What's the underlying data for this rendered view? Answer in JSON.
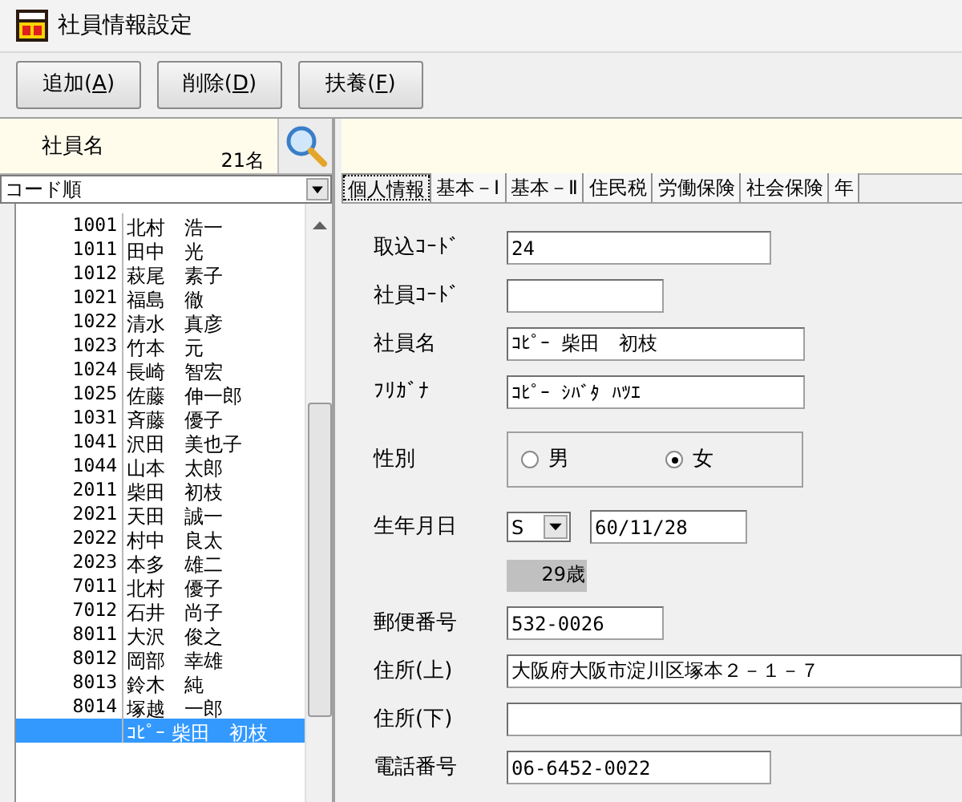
{
  "window": {
    "title": "社員情報設定"
  },
  "toolbar": [
    {
      "label": "追加(",
      "key": "A",
      "tail": ")"
    },
    {
      "label": "削除(",
      "key": "D",
      "tail": ")"
    },
    {
      "label": "扶養(",
      "key": "F",
      "tail": ")"
    }
  ],
  "employee_panel": {
    "label": "社員名",
    "count": "21名",
    "sort": "コード順",
    "rows": [
      {
        "code": "1001",
        "name": "北村　浩一",
        "selected": false
      },
      {
        "code": "1011",
        "name": "田中　光",
        "selected": false
      },
      {
        "code": "1012",
        "name": "萩尾　素子",
        "selected": false
      },
      {
        "code": "1021",
        "name": "福島　徹",
        "selected": false
      },
      {
        "code": "1022",
        "name": "清水　真彦",
        "selected": false
      },
      {
        "code": "1023",
        "name": "竹本　元",
        "selected": false
      },
      {
        "code": "1024",
        "name": "長崎　智宏",
        "selected": false
      },
      {
        "code": "1025",
        "name": "佐藤　伸一郎",
        "selected": false
      },
      {
        "code": "1031",
        "name": "斉藤　優子",
        "selected": false
      },
      {
        "code": "1041",
        "name": "沢田　美也子",
        "selected": false
      },
      {
        "code": "1044",
        "name": "山本　太郎",
        "selected": false
      },
      {
        "code": "2011",
        "name": "柴田　初枝",
        "selected": false
      },
      {
        "code": "2021",
        "name": "天田　誠一",
        "selected": false
      },
      {
        "code": "2022",
        "name": "村中　良太",
        "selected": false
      },
      {
        "code": "2023",
        "name": "本多　雄二",
        "selected": false
      },
      {
        "code": "7011",
        "name": "北村　優子",
        "selected": false
      },
      {
        "code": "7012",
        "name": "石井　尚子",
        "selected": false
      },
      {
        "code": "8011",
        "name": "大沢　俊之",
        "selected": false
      },
      {
        "code": "8012",
        "name": "岡部　幸雄",
        "selected": false
      },
      {
        "code": "8013",
        "name": "鈴木　純",
        "selected": false
      },
      {
        "code": "8014",
        "name": "塚越　一郎",
        "selected": false
      },
      {
        "name": "ｺﾋﾟｰ 柴田　初枝",
        "selected": true
      }
    ]
  },
  "tabs": [
    {
      "label": "個人情報",
      "selected": true
    },
    {
      "label": "基本－Ⅰ",
      "selected": false
    },
    {
      "label": "基本－Ⅱ",
      "selected": false
    },
    {
      "label": "住民税",
      "selected": false
    },
    {
      "label": "労働保険",
      "selected": false
    },
    {
      "label": "社会保険",
      "selected": false
    },
    {
      "label": "年",
      "selected": false
    }
  ],
  "form": [
    {
      "kind": "text",
      "label": "取込ｺｰﾄﾞ",
      "value": "24"
    },
    {
      "kind": "text",
      "label": "社員ｺｰﾄﾞ"
    },
    {
      "kind": "text",
      "label": "社員名",
      "value": "ｺﾋﾟｰ 柴田　初枝"
    },
    {
      "kind": "text",
      "label": "ﾌﾘｶﾞﾅ",
      "value": "ｺﾋﾟｰ ｼﾊﾞﾀ ﾊﾂｴ"
    },
    {
      "kind": "radio",
      "label": "性別",
      "options": [
        {
          "label": "男",
          "selected": false
        },
        {
          "label": "女",
          "selected": true
        }
      ]
    },
    {
      "kind": "date",
      "label": "生年月日",
      "era": "S",
      "value": "60/11/28"
    },
    {
      "kind": "age",
      "value": "29歳"
    },
    {
      "kind": "text",
      "label": "郵便番号",
      "value": "532-0026"
    },
    {
      "kind": "text",
      "label": "住所(上)",
      "value": "大阪府大阪市淀川区塚本２－１－７"
    },
    {
      "kind": "text",
      "label": "住所(下)"
    },
    {
      "kind": "text",
      "label": "電話番号",
      "value": "06-6452-0022"
    }
  ]
}
